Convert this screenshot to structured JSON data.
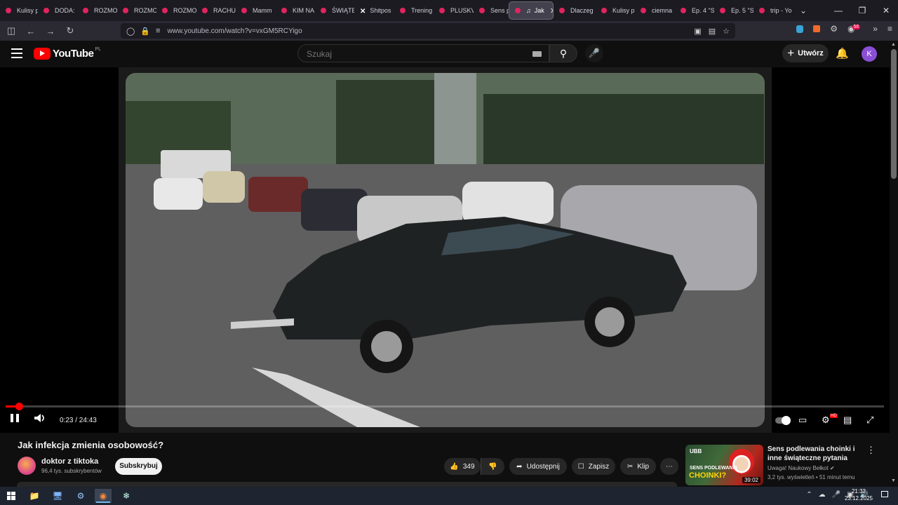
{
  "browser": {
    "tabs": [
      {
        "label": "Kulisy p",
        "favicon": "youtube-icon",
        "width": 54
      },
      {
        "label": "DODA:",
        "favicon": "youtube-icon",
        "width": 56
      },
      {
        "label": "ROZMO",
        "favicon": "youtube-icon",
        "width": 57
      },
      {
        "label": "ROZMO",
        "favicon": "youtube-icon",
        "width": 56
      },
      {
        "label": "ROZMO",
        "favicon": "youtube-icon",
        "width": 57
      },
      {
        "label": "RACHU",
        "favicon": "youtube-icon",
        "width": 56
      },
      {
        "label": "Mamm",
        "favicon": "youtube-icon",
        "width": 57
      },
      {
        "label": "KIM NA",
        "favicon": "youtube-icon",
        "width": 56
      },
      {
        "label": "ŚWIĄTE",
        "favicon": "youtube-icon",
        "width": 56
      },
      {
        "label": "Shitpos",
        "favicon": "x-icon",
        "width": 57
      },
      {
        "label": "Trening",
        "favicon": "youtube-icon",
        "width": 56
      },
      {
        "label": "PLUSKV",
        "favicon": "youtube-icon",
        "width": 57
      },
      {
        "label": "Sens po",
        "favicon": "youtube-icon",
        "width": 50
      },
      {
        "label": "Jak",
        "favicon": "youtube-icon",
        "active": true,
        "audio": true,
        "width": 64
      },
      {
        "label": "Dlaczeg",
        "favicon": "youtube-icon",
        "width": 60
      },
      {
        "label": "Kulisy p",
        "favicon": "youtube-icon",
        "width": 56
      },
      {
        "label": "ciemna",
        "favicon": "youtube-icon",
        "width": 57
      },
      {
        "label": "Ep. 4 \"S",
        "favicon": "youtube-icon",
        "width": 56
      },
      {
        "label": "Ep. 5 \"S",
        "favicon": "youtube-icon",
        "width": 56
      },
      {
        "label": "trip - Yo",
        "favicon": "youtube-icon",
        "width": 56
      }
    ],
    "url": "www.youtube.com/watch?v=vxGM5RCYigo",
    "extension_badge": "56"
  },
  "youtube": {
    "logo_text": "YouTube",
    "region": "PL",
    "search_placeholder": "Szukaj",
    "create_label": "Utwórz",
    "avatar_letter": "K"
  },
  "player": {
    "current_time": "0:23",
    "duration": "24:43",
    "time_display": "0:23 / 24:43",
    "progress": 0.0155,
    "hd_badge": "HD",
    "playing": true
  },
  "video": {
    "title": "Jak infekcja zmienia osobowość?",
    "channel": "doktor z tiktoka",
    "subscribers": "96,4 tys. subskrybentów",
    "subscribe_label": "Subskrybuj",
    "likes": "349",
    "share_label": "Udostępnij",
    "save_label": "Zapisz",
    "clip_label": "Klip"
  },
  "recommendation": {
    "title": "Sens podlewania choinki i inne świąteczne pytania",
    "channel": "Uwaga! Naukowy Bełkot",
    "meta": "3,2 tys. wyświetleń • 51 minut temu",
    "duration": "39:02",
    "thumb_brand": "UBB",
    "thumb_line1": "SENS PODLEWANIA",
    "thumb_line2": "CHOINKI?"
  },
  "taskbar": {
    "time": "21:32",
    "date": "23.12.2025"
  },
  "colors": {
    "yt_red": "#ff0000",
    "background": "#0f0f0f",
    "tab_favicon": "#e0245e"
  }
}
